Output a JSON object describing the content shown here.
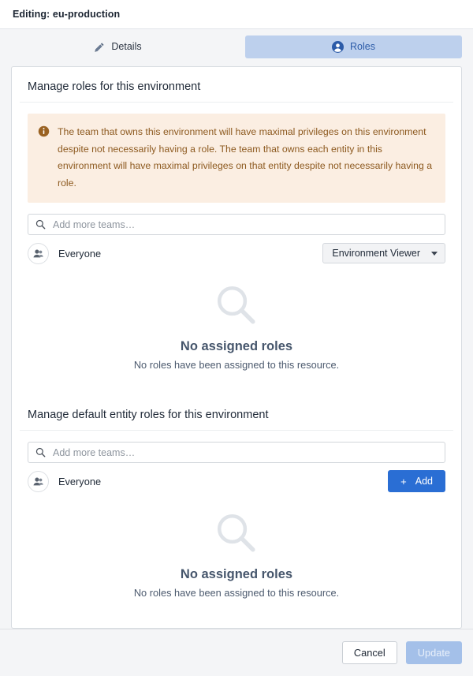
{
  "header": {
    "title": "Editing: eu-production"
  },
  "tabs": [
    {
      "label": "Details",
      "icon": "pencil-icon",
      "active": false
    },
    {
      "label": "Roles",
      "icon": "person-icon",
      "active": true
    }
  ],
  "sections": [
    {
      "title": "Manage roles for this environment",
      "callout": {
        "icon": "info-icon",
        "text": "The team that owns this environment will have maximal privileges on this environment despite not necessarily having a role. The team that owns each entity in this environment will have maximal privileges on that entity despite not necessarily having a role."
      },
      "search": {
        "placeholder": "Add more teams…",
        "value": "",
        "icon": "search-icon"
      },
      "team": {
        "name": "Everyone",
        "avatar_icon": "group-avatar-icon"
      },
      "role_select": {
        "value": "Environment Viewer",
        "caret_icon": "chevron-down-icon"
      },
      "empty_state": {
        "icon": "magnifier-icon",
        "title": "No assigned roles",
        "description": "No roles have been assigned to this resource."
      }
    },
    {
      "title": "Manage default entity roles for this environment",
      "search": {
        "placeholder": "Add more teams…",
        "value": "",
        "icon": "search-icon"
      },
      "team": {
        "name": "Everyone",
        "avatar_icon": "group-avatar-icon"
      },
      "add_button": {
        "label": "Add",
        "plus": "+",
        "icon": "plus-icon"
      },
      "empty_state": {
        "icon": "magnifier-icon",
        "title": "No assigned roles",
        "description": "No roles have been assigned to this resource."
      }
    }
  ],
  "footer": {
    "cancel_label": "Cancel",
    "update_label": "Update"
  },
  "colors": {
    "tab_active_bg": "#bdd0ed",
    "tab_active_text": "#2c5ba8",
    "callout_bg": "#fbeee2",
    "callout_text": "#8d5a20",
    "primary_button": "#2a6ed4",
    "disabled_button": "#a4c0e9",
    "page_bg": "#f4f5f7"
  }
}
